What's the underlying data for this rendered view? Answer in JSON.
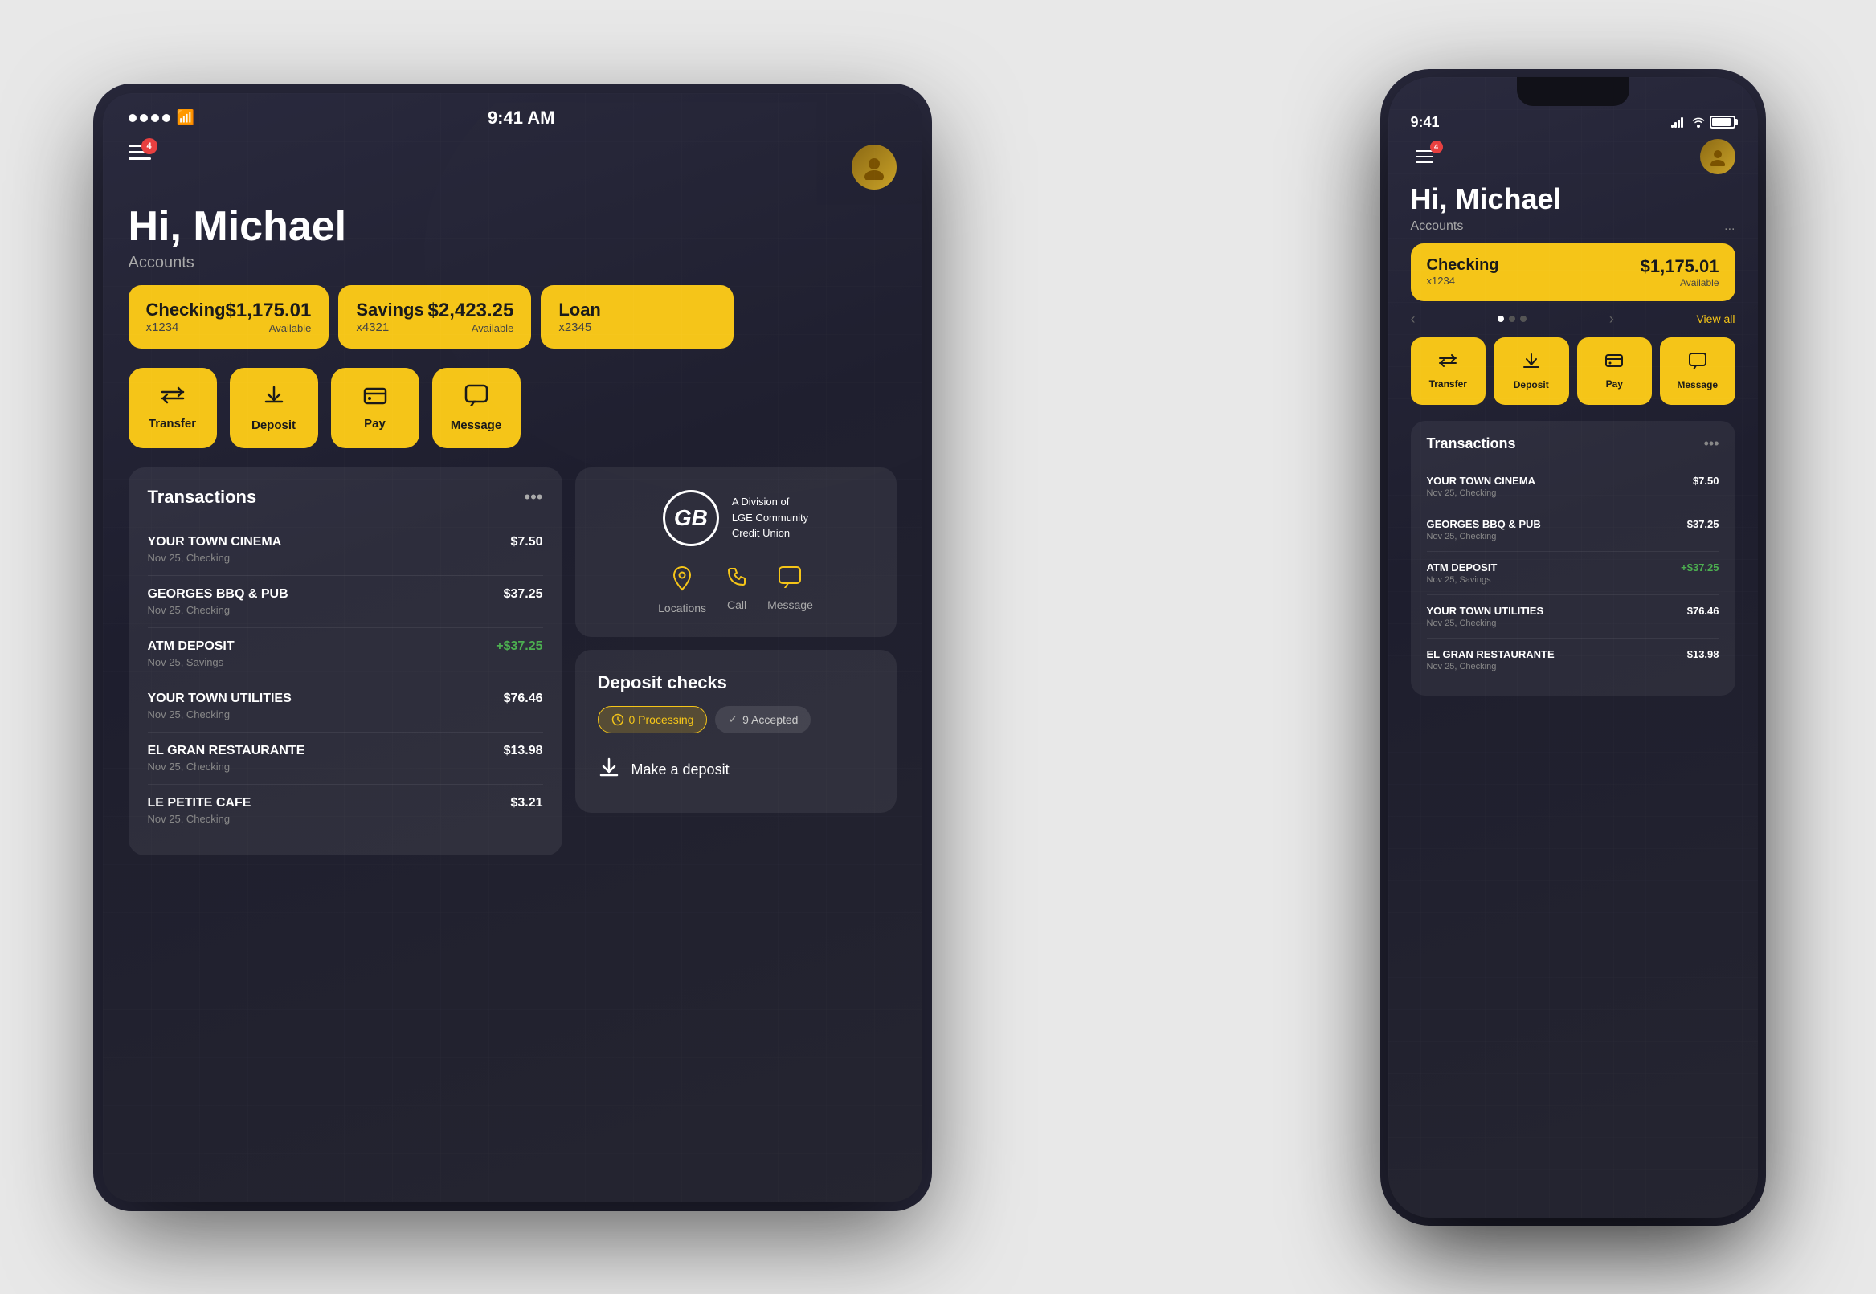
{
  "scene": {
    "bg_color": "#c8c8c8"
  },
  "tablet": {
    "status_bar": {
      "time": "9:41 AM",
      "signal": "●●●●",
      "wifi": "wifi"
    },
    "greeting": "Hi, Michael",
    "accounts_label": "Accounts",
    "notification_count": "4",
    "accounts": [
      {
        "name": "Checking",
        "number": "x1234",
        "amount": "$1,175.01",
        "available": "Available"
      },
      {
        "name": "Savings",
        "number": "x4321",
        "amount": "$2,423.25",
        "available": "Available"
      },
      {
        "name": "Loan",
        "number": "x2345",
        "amount": "$",
        "available": ""
      }
    ],
    "actions": [
      {
        "label": "Transfer",
        "icon": "⇄"
      },
      {
        "label": "Deposit",
        "icon": "⬇"
      },
      {
        "label": "Pay",
        "icon": "💳"
      },
      {
        "label": "Message",
        "icon": "💬"
      }
    ],
    "transactions": {
      "title": "Transactions",
      "items": [
        {
          "name": "YOUR TOWN CINEMA",
          "sub": "Nov 25, Checking",
          "amount": "$7.50",
          "positive": false
        },
        {
          "name": "GEORGES BBQ & PUB",
          "sub": "Nov 25, Checking",
          "amount": "$37.25",
          "positive": false
        },
        {
          "name": "ATM DEPOSIT",
          "sub": "Nov 25, Savings",
          "amount": "+$37.25",
          "positive": true
        },
        {
          "name": "YOUR TOWN UTILITIES",
          "sub": "Nov 25, Checking",
          "amount": "$76.46",
          "positive": false
        },
        {
          "name": "EL GRAN RESTAURANTE",
          "sub": "Nov 25, Checking",
          "amount": "$13.98",
          "positive": false
        },
        {
          "name": "LE PETITE CAFE",
          "sub": "Nov 25, Checking",
          "amount": "$3.21",
          "positive": false
        }
      ]
    },
    "bank": {
      "initials": "GB",
      "name": "A Division of\nLGE Community\nCredit Union",
      "contacts": [
        {
          "label": "Locations",
          "icon": "📍"
        },
        {
          "label": "Call",
          "icon": "📞"
        },
        {
          "label": "Message",
          "icon": "💬"
        }
      ]
    },
    "deposit_checks": {
      "title": "Deposit checks",
      "processing_label": "0 Processing",
      "accepted_label": "9 Accepted",
      "make_deposit_label": "Make a deposit"
    }
  },
  "phone": {
    "status_bar": {
      "time": "9:41",
      "battery": "100%"
    },
    "notification_count": "4",
    "greeting": "Hi, Michael",
    "accounts_label": "Accounts",
    "more_label": "...",
    "account": {
      "name": "Checking",
      "number": "x1234",
      "amount": "$1,175.01",
      "available": "Available"
    },
    "view_all": "View all",
    "actions": [
      {
        "label": "Transfer",
        "icon": "⇄"
      },
      {
        "label": "Deposit",
        "icon": "⬇"
      },
      {
        "label": "Pay",
        "icon": "💳"
      },
      {
        "label": "Message",
        "icon": "💬"
      }
    ],
    "transactions": {
      "title": "Transactions",
      "items": [
        {
          "name": "YOUR TOWN CINEMA",
          "sub": "Nov 25, Checking",
          "amount": "$7.50",
          "positive": false
        },
        {
          "name": "GEORGES BBQ & PUB",
          "sub": "Nov 25, Checking",
          "amount": "$37.25",
          "positive": false
        },
        {
          "name": "ATM Deposit",
          "sub": "Nov 25, Savings",
          "amount": "+$37.25",
          "positive": true
        },
        {
          "name": "YOUR TOWN UTILITIES",
          "sub": "Nov 25, Checking",
          "amount": "$76.46",
          "positive": false
        },
        {
          "name": "EL GRAN RESTAURANTE",
          "sub": "Nov 25, Checking",
          "amount": "$13.98",
          "positive": false
        }
      ]
    }
  }
}
